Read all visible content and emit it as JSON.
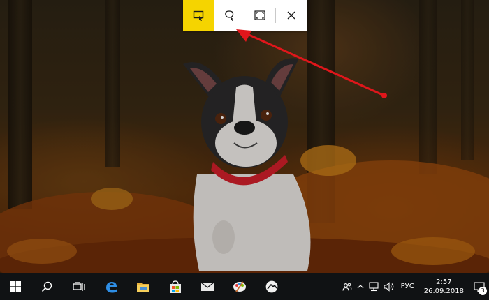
{
  "snip_toolbar": {
    "modes": [
      {
        "icon": "rectangular-snip-icon",
        "active": true
      },
      {
        "icon": "freeform-snip-icon",
        "active": false
      },
      {
        "icon": "fullscreen-snip-icon",
        "active": false
      }
    ],
    "close_icon": "close-icon",
    "accent_color": "#f5d400"
  },
  "annotation": {
    "arrow_color": "#e0161b"
  },
  "taskbar": {
    "pinned": [
      {
        "name": "start",
        "icon": "windows-logo-icon"
      },
      {
        "name": "search",
        "icon": "search-icon"
      },
      {
        "name": "task-view",
        "icon": "task-view-icon"
      },
      {
        "name": "edge",
        "icon": "edge-browser-icon"
      },
      {
        "name": "file-explorer",
        "icon": "folder-icon"
      },
      {
        "name": "store",
        "icon": "store-icon"
      },
      {
        "name": "mail",
        "icon": "mail-icon"
      },
      {
        "name": "paint",
        "icon": "paint-icon"
      },
      {
        "name": "app",
        "icon": "app-icon"
      }
    ],
    "tray": {
      "language": "РУС",
      "time": "2:57",
      "date": "26.09.2018",
      "notification_count": "3"
    }
  }
}
